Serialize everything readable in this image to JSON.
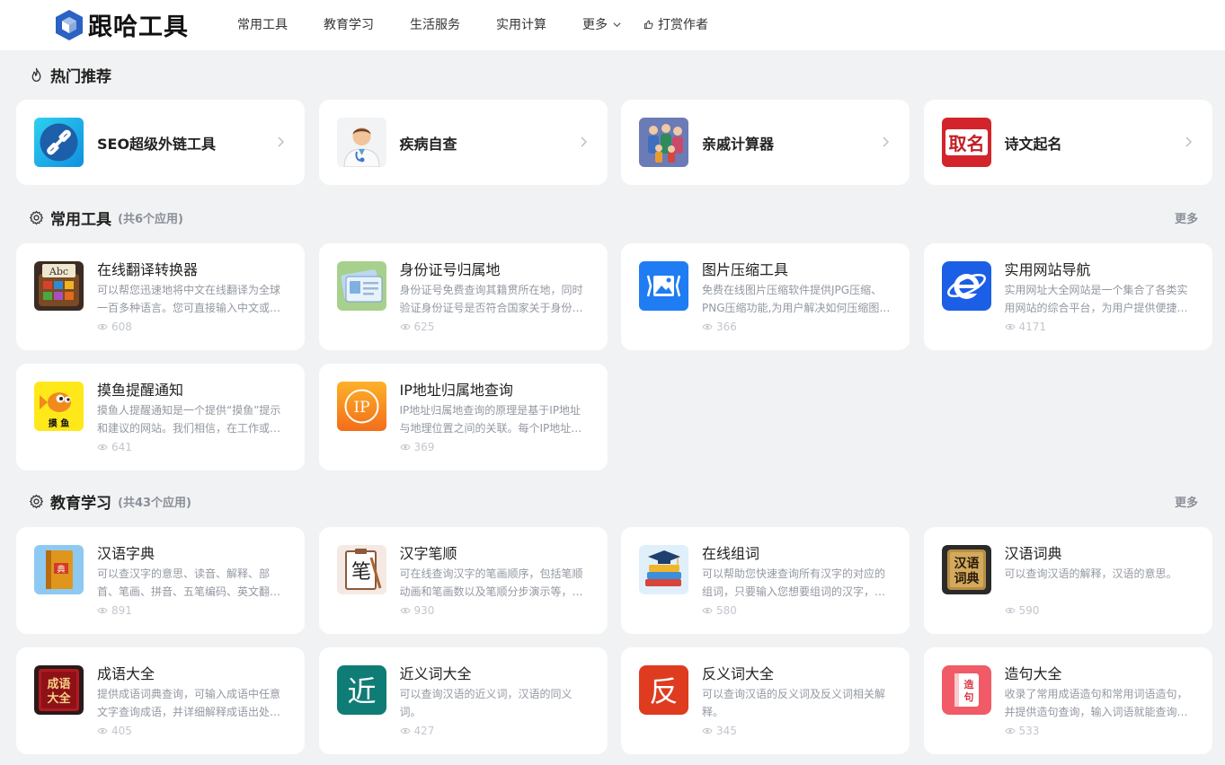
{
  "brand": {
    "name": "跟哈工具"
  },
  "nav": {
    "items": [
      "常用工具",
      "教育学习",
      "生活服务",
      "实用计算"
    ],
    "more": "更多",
    "donate": "打赏作者"
  },
  "hot": {
    "title": "热门推荐",
    "items": [
      {
        "name": "SEO超级外链工具"
      },
      {
        "name": "疾病自查"
      },
      {
        "name": "亲戚计算器"
      },
      {
        "name": "诗文起名"
      }
    ]
  },
  "common": {
    "title": "常用工具",
    "count": "(共6个应用)",
    "more": "更多",
    "items": [
      {
        "name": "在线翻译转换器",
        "desc": "可以帮您迅速地将中文在线翻译为全球一百多种语言。您可直接输入中文或…",
        "views": "608"
      },
      {
        "name": "身份证号归属地",
        "desc": "身份证号免费查询其籍贯所在地，同时验证身份证号是否符合国家关于身份…",
        "views": "625"
      },
      {
        "name": "图片压缩工具",
        "desc": "免费在线图片压缩软件提供JPG压缩、PNG压缩功能,为用户解决如何压缩图…",
        "views": "366"
      },
      {
        "name": "实用网站导航",
        "desc": "实用网址大全网站是一个集合了各类实用网站的综合平台，为用户提供便捷…",
        "views": "4171"
      },
      {
        "name": "摸鱼提醒通知",
        "desc": "摸鱼人提醒通知是一个提供“摸鱼”提示和建议的网站。我们相信，在工作或…",
        "views": "641"
      },
      {
        "name": "IP地址归属地查询",
        "desc": "IP地址归属地查询的原理是基于IP地址与地理位置之间的关联。每个IP地址…",
        "views": "369"
      }
    ]
  },
  "edu": {
    "title": "教育学习",
    "count": "(共43个应用)",
    "more": "更多",
    "items": [
      {
        "name": "汉语字典",
        "desc": "可以查汉字的意思、读音、解释、部首、笔画、拼音、五笔编码、英文翻…",
        "views": "891"
      },
      {
        "name": "汉字笔顺",
        "desc": "可在线查询汉字的笔画顺序，包括笔顺动画和笔画数以及笔顺分步演示等，…",
        "views": "930"
      },
      {
        "name": "在线组词",
        "desc": "可以帮助您快速查询所有汉字的对应的组词，只要输入您想要组词的汉字，…",
        "views": "580"
      },
      {
        "name": "汉语词典",
        "desc": "可以查询汉语的解释，汉语的意思。",
        "views": "590"
      },
      {
        "name": "成语大全",
        "desc": "提供成语词典查询，可输入成语中任意文字查询成语，并详细解释成语出处…",
        "views": "405"
      },
      {
        "name": "近义词大全",
        "desc": "可以查询汉语的近义词，汉语的同义词。",
        "views": "427"
      },
      {
        "name": "反义词大全",
        "desc": "可以查询汉语的反义词及反义词相关解释。",
        "views": "345"
      },
      {
        "name": "造句大全",
        "desc": "收录了常用成语造句和常用词语造句，并提供造句查询，输入词语就能查询…",
        "views": "533"
      }
    ]
  },
  "icon_glyphs": {
    "dict": "典",
    "stroke": "笔",
    "ci": "汉语词典",
    "chengyu": "成语大全",
    "jin": "近",
    "fan": "反",
    "zao": "造句",
    "ip": "IP",
    "moyu": "摸 鱼",
    "abc": "Abc",
    "qm": "取名"
  },
  "colors": {
    "accent": "#2b62c3",
    "card": "#ffffff",
    "bg": "#f1f2f3",
    "muted": "#9398a1"
  }
}
